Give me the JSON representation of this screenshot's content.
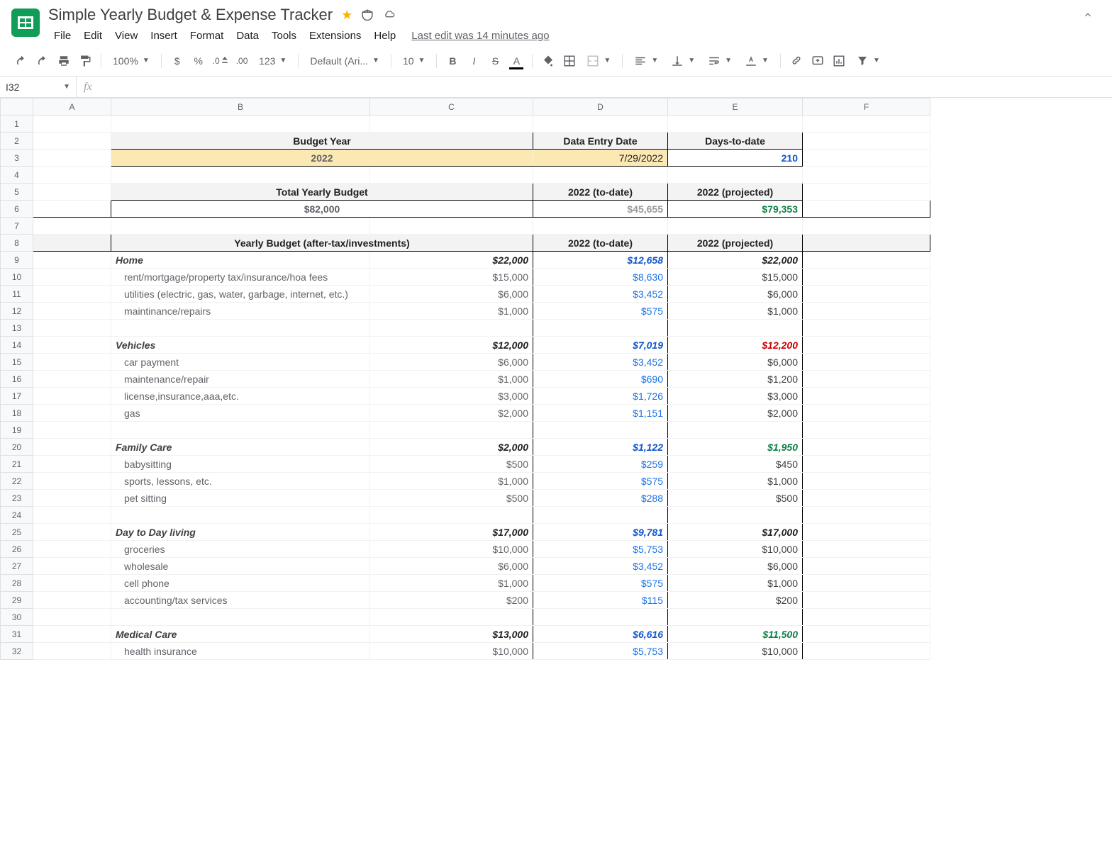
{
  "doc": {
    "title": "Simple Yearly Budget & Expense Tracker",
    "last_edit": "Last edit was 14 minutes ago"
  },
  "menu": [
    "File",
    "Edit",
    "View",
    "Insert",
    "Format",
    "Data",
    "Tools",
    "Extensions",
    "Help"
  ],
  "toolbar": {
    "zoom": "100%",
    "currency": "$",
    "percent": "%",
    "dec_dec": ".0",
    "inc_dec": ".00",
    "format_num": "123",
    "font": "Default (Ari...",
    "font_size": "10"
  },
  "namebox": "I32",
  "columns": [
    "A",
    "B",
    "C",
    "D",
    "E",
    "F"
  ],
  "headers1": {
    "budget_year": "Budget Year",
    "entry_date": "Data Entry Date",
    "days": "Days-to-date",
    "year_val": "2022",
    "date_val": "7/29/2022",
    "days_val": "210"
  },
  "totals": {
    "label": "Total Yearly Budget",
    "h2": "2022 (to-date)",
    "h3": "2022 (projected)",
    "budget": "$82,000",
    "todate": "$45,655",
    "projected": "$79,353"
  },
  "section": {
    "h1": "Yearly Budget (after-tax/investments)",
    "h2": "2022 (to-date)",
    "h3": "2022 (projected)"
  },
  "categories": [
    {
      "name": "Home",
      "budget": "$22,000",
      "todate": "$12,658",
      "projected": "$22,000",
      "proj_class": "",
      "items": [
        {
          "name": "rent/mortgage/property tax/insurance/hoa fees",
          "budget": "$15,000",
          "todate": "$8,630",
          "projected": "$15,000",
          "proj_class": ""
        },
        {
          "name": "utilities (electric, gas, water, garbage, internet, etc.)",
          "budget": "$6,000",
          "todate": "$3,452",
          "projected": "$6,000",
          "proj_class": ""
        },
        {
          "name": "maintinance/repairs",
          "budget": "$1,000",
          "todate": "$575",
          "projected": "$1,000",
          "proj_class": ""
        }
      ]
    },
    {
      "name": "Vehicles",
      "budget": "$12,000",
      "todate": "$7,019",
      "projected": "$12,200",
      "proj_class": "proj-red",
      "items": [
        {
          "name": "car payment",
          "budget": "$6,000",
          "todate": "$3,452",
          "projected": "$6,000",
          "proj_class": ""
        },
        {
          "name": "maintenance/repair",
          "budget": "$1,000",
          "todate": "$690",
          "projected": "$1,200",
          "proj_class": "proj-red"
        },
        {
          "name": "license,insurance,aaa,etc.",
          "budget": "$3,000",
          "todate": "$1,726",
          "projected": "$3,000",
          "proj_class": ""
        },
        {
          "name": "gas",
          "budget": "$2,000",
          "todate": "$1,151",
          "projected": "$2,000",
          "proj_class": ""
        }
      ]
    },
    {
      "name": "Family Care",
      "budget": "$2,000",
      "todate": "$1,122",
      "projected": "$1,950",
      "proj_class": "proj-green",
      "items": [
        {
          "name": "babysitting",
          "budget": "$500",
          "todate": "$259",
          "projected": "$450",
          "proj_class": "proj-green"
        },
        {
          "name": "sports, lessons, etc.",
          "budget": "$1,000",
          "todate": "$575",
          "projected": "$1,000",
          "proj_class": ""
        },
        {
          "name": "pet sitting",
          "budget": "$500",
          "todate": "$288",
          "projected": "$500",
          "proj_class": ""
        }
      ]
    },
    {
      "name": "Day to Day living",
      "budget": "$17,000",
      "todate": "$9,781",
      "projected": "$17,000",
      "proj_class": "",
      "items": [
        {
          "name": "groceries",
          "budget": "$10,000",
          "todate": "$5,753",
          "projected": "$10,000",
          "proj_class": ""
        },
        {
          "name": "wholesale",
          "budget": "$6,000",
          "todate": "$3,452",
          "projected": "$6,000",
          "proj_class": ""
        },
        {
          "name": "cell phone",
          "budget": "$1,000",
          "todate": "$575",
          "projected": "$1,000",
          "proj_class": ""
        },
        {
          "name": "accounting/tax services",
          "budget": "$200",
          "todate": "$115",
          "projected": "$200",
          "proj_class": ""
        }
      ]
    },
    {
      "name": "Medical Care",
      "budget": "$13,000",
      "todate": "$6,616",
      "projected": "$11,500",
      "proj_class": "proj-green",
      "items": [
        {
          "name": "health insurance",
          "budget": "$10,000",
          "todate": "$5,753",
          "projected": "$10,000",
          "proj_class": ""
        }
      ]
    }
  ]
}
